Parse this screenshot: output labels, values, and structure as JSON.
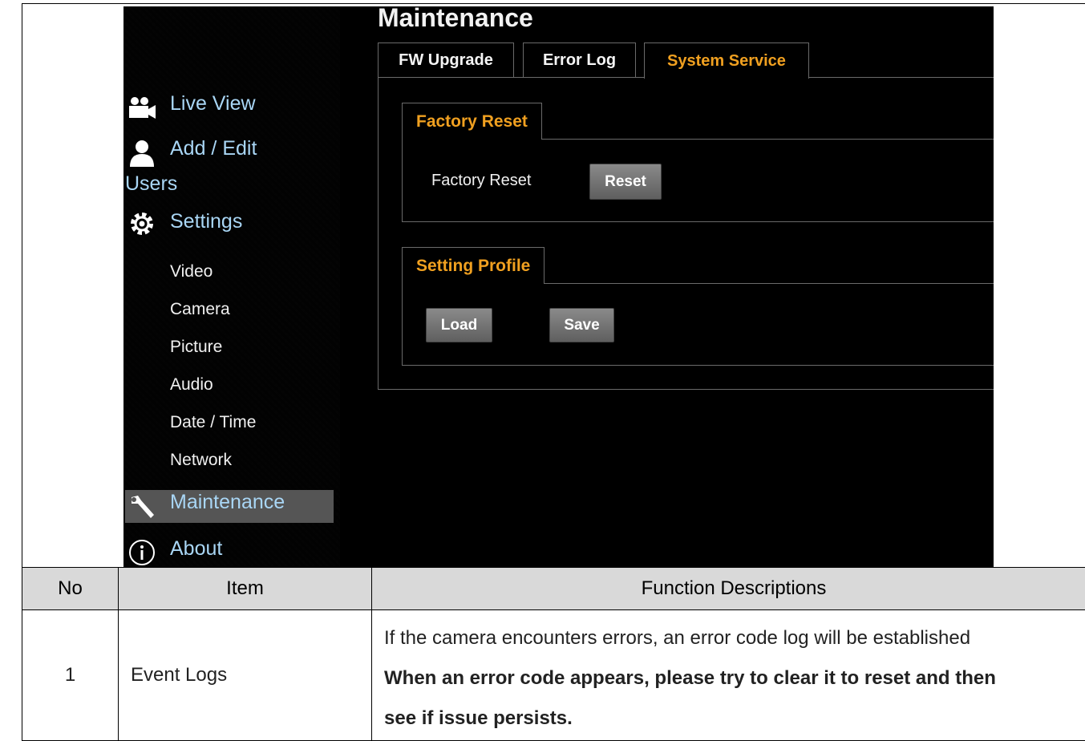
{
  "sidebar": {
    "live_view": "Live View",
    "add_edit": "Add / Edit",
    "users": "Users",
    "settings": "Settings",
    "sub_items": [
      "Video",
      "Camera",
      "Picture",
      "Audio",
      "Date / Time",
      "Network"
    ],
    "maintenance": "Maintenance",
    "about": "About"
  },
  "main": {
    "title": "Maintenance",
    "tabs": [
      "FW Upgrade",
      "Error Log",
      "System Service"
    ],
    "active_tab": "System Service",
    "factory_reset": {
      "group_title": "Factory Reset",
      "label": "Factory Reset",
      "button": "Reset"
    },
    "setting_profile": {
      "group_title": "Setting Profile",
      "load_button": "Load",
      "save_button": "Save"
    }
  },
  "table": {
    "headers": [
      "No",
      "Item",
      "Function Descriptions"
    ],
    "rows": [
      {
        "no": "1",
        "item": "Event Logs",
        "desc_line1": "If the camera encounters errors, an error code log will be established",
        "desc_line2": "When an error code appears, please try to clear it to reset and then",
        "desc_line3": "see if issue persists."
      }
    ]
  },
  "colors": {
    "accent": "#f0a020",
    "nav_text": "#a9d6f5",
    "header_bg": "#d9d9d9"
  },
  "icons": [
    "camera-icon",
    "user-icon",
    "gear-icon",
    "wrench-icon",
    "info-icon"
  ]
}
